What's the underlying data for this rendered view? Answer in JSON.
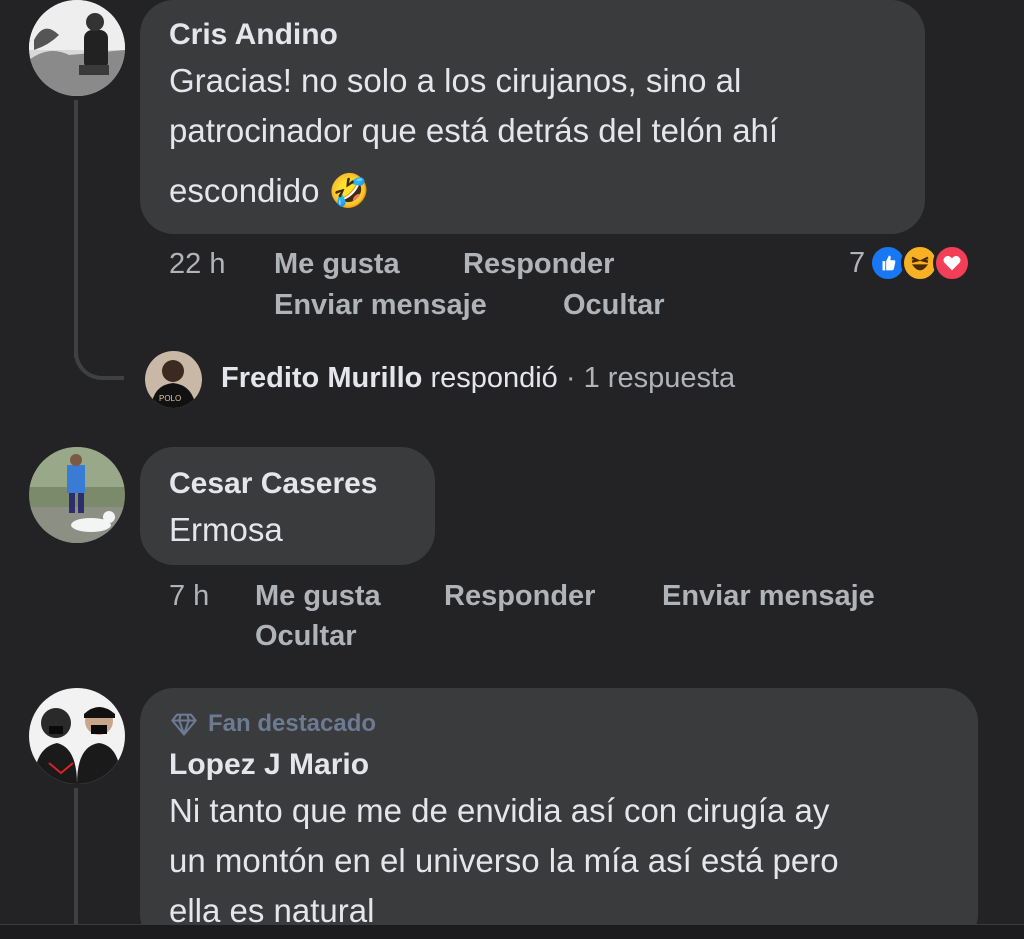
{
  "comments": [
    {
      "author": "Cris Andino",
      "text_lines": [
        "Gracias! no solo a los cirujanos, sino al",
        "patrocinador que está detrás del telón ahí",
        "escondido 🤣"
      ],
      "time": "22 h",
      "like": "Me gusta",
      "reply": "Responder",
      "message": "Enviar mensaje",
      "hide": "Ocultar",
      "reaction_count": "7",
      "reactions": [
        "like-reaction-icon",
        "haha-reaction-icon",
        "love-reaction-icon"
      ]
    },
    {
      "author": "Cesar Caseres",
      "text_lines": [
        "Ermosa"
      ],
      "time": "7 h",
      "like": "Me gusta",
      "reply": "Responder",
      "message": "Enviar mensaje",
      "hide": "Ocultar"
    },
    {
      "badge": "Fan destacado",
      "author": "Lopez J Mario",
      "text_lines": [
        "Ni tanto que me de envidia así con cirugía ay",
        "un montón en el universo la mía así está pero",
        "ella es natural"
      ]
    }
  ],
  "reply_summary": {
    "name": "Fredito Murillo",
    "verb": "respondió",
    "separator": "·",
    "count": "1 respuesta"
  },
  "colors": {
    "background": "#232325",
    "bubble": "#3a3b3c",
    "text": "#e4e6eb",
    "muted": "#b0b3b8",
    "like_blue": "#1877f2",
    "love_red": "#f33e58",
    "haha_yellow": "#f7b125"
  }
}
